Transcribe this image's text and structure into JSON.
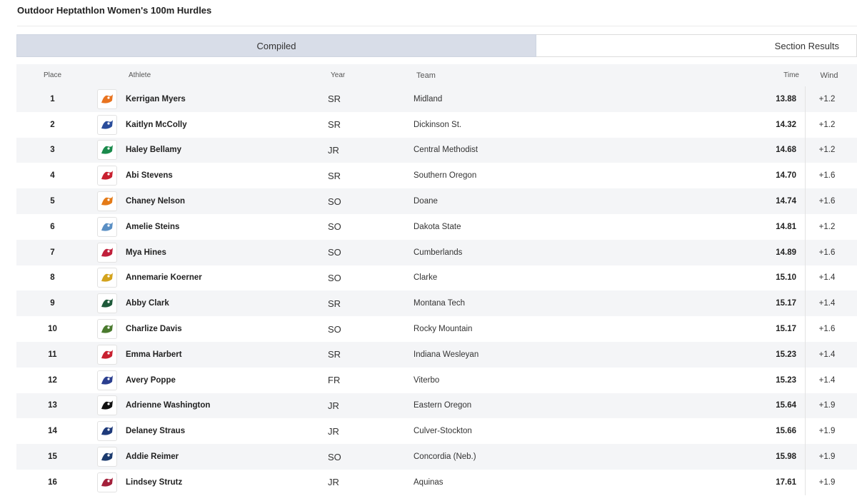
{
  "page": {
    "title": "Outdoor Heptathlon Women's 100m Hurdles"
  },
  "tabs": [
    {
      "label": "Compiled",
      "active": true
    },
    {
      "label": "Section Results",
      "active": false
    }
  ],
  "columns": {
    "place": "Place",
    "athlete": "Athlete",
    "year": "Year",
    "team": "Team",
    "time": "Time",
    "wind": "Wind"
  },
  "results": [
    {
      "place": "1",
      "athlete": "Kerrigan Myers",
      "year": "SR",
      "team": "Midland",
      "time": "13.88",
      "wind": "+1.2",
      "logo_icon": "midland-logo-icon",
      "logo_color": "#e8731f"
    },
    {
      "place": "2",
      "athlete": "Kaitlyn McColly",
      "year": "SR",
      "team": "Dickinson St.",
      "time": "14.32",
      "wind": "+1.2",
      "logo_icon": "dickinson-state-logo-icon",
      "logo_color": "#2a4d9b"
    },
    {
      "place": "3",
      "athlete": "Haley Bellamy",
      "year": "JR",
      "team": "Central Methodist",
      "time": "14.68",
      "wind": "+1.2",
      "logo_icon": "central-methodist-logo-icon",
      "logo_color": "#1a8a4b"
    },
    {
      "place": "4",
      "athlete": "Abi Stevens",
      "year": "SR",
      "team": "Southern Oregon",
      "time": "14.70",
      "wind": "+1.6",
      "logo_icon": "southern-oregon-logo-icon",
      "logo_color": "#c8202f"
    },
    {
      "place": "5",
      "athlete": "Chaney Nelson",
      "year": "SO",
      "team": "Doane",
      "time": "14.74",
      "wind": "+1.6",
      "logo_icon": "doane-logo-icon",
      "logo_color": "#e47a17"
    },
    {
      "place": "6",
      "athlete": "Amelie Steins",
      "year": "SO",
      "team": "Dakota State",
      "time": "14.81",
      "wind": "+1.2",
      "logo_icon": "dakota-state-logo-icon",
      "logo_color": "#5a8fc4"
    },
    {
      "place": "7",
      "athlete": "Mya Hines",
      "year": "SO",
      "team": "Cumberlands",
      "time": "14.89",
      "wind": "+1.6",
      "logo_icon": "cumberlands-logo-icon",
      "logo_color": "#c01f3a"
    },
    {
      "place": "8",
      "athlete": "Annemarie Koerner",
      "year": "SO",
      "team": "Clarke",
      "time": "15.10",
      "wind": "+1.4",
      "logo_icon": "clarke-logo-icon",
      "logo_color": "#d3a31d"
    },
    {
      "place": "9",
      "athlete": "Abby Clark",
      "year": "SR",
      "team": "Montana Tech",
      "time": "15.17",
      "wind": "+1.4",
      "logo_icon": "montana-tech-logo-icon",
      "logo_color": "#1e5a3a"
    },
    {
      "place": "10",
      "athlete": "Charlize Davis",
      "year": "SO",
      "team": "Rocky Mountain",
      "time": "15.17",
      "wind": "+1.6",
      "logo_icon": "rocky-mountain-logo-icon",
      "logo_color": "#4a7a2e"
    },
    {
      "place": "11",
      "athlete": "Emma Harbert",
      "year": "SR",
      "team": "Indiana Wesleyan",
      "time": "15.23",
      "wind": "+1.4",
      "logo_icon": "indiana-wesleyan-logo-icon",
      "logo_color": "#c8202f"
    },
    {
      "place": "12",
      "athlete": "Avery Poppe",
      "year": "FR",
      "team": "Viterbo",
      "time": "15.23",
      "wind": "+1.4",
      "logo_icon": "viterbo-logo-icon",
      "logo_color": "#2b3f8f"
    },
    {
      "place": "13",
      "athlete": "Adrienne Washington",
      "year": "JR",
      "team": "Eastern Oregon",
      "time": "15.64",
      "wind": "+1.9",
      "logo_icon": "eastern-oregon-logo-icon",
      "logo_color": "#111111"
    },
    {
      "place": "14",
      "athlete": "Delaney Straus",
      "year": "JR",
      "team": "Culver-Stockton",
      "time": "15.66",
      "wind": "+1.9",
      "logo_icon": "culver-stockton-logo-icon",
      "logo_color": "#1e3a7a"
    },
    {
      "place": "15",
      "athlete": "Addie Reimer",
      "year": "SO",
      "team": "Concordia (Neb.)",
      "time": "15.98",
      "wind": "+1.9",
      "logo_icon": "concordia-neb-logo-icon",
      "logo_color": "#1c3b6e"
    },
    {
      "place": "16",
      "athlete": "Lindsey Strutz",
      "year": "JR",
      "team": "Aquinas",
      "time": "17.61",
      "wind": "+1.9",
      "logo_icon": "aquinas-logo-icon",
      "logo_color": "#a3203a"
    }
  ],
  "colors": {
    "active_tab": "#d8dde8",
    "row_stripe": "#f4f5f7"
  }
}
